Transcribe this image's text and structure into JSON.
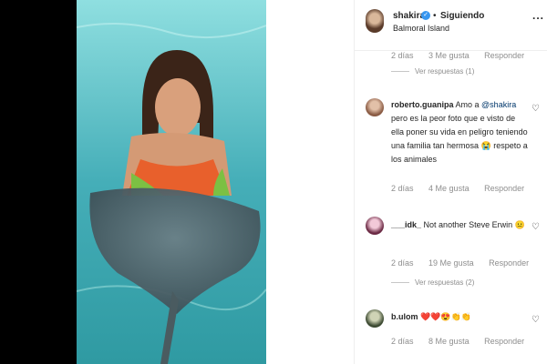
{
  "post": {
    "username": "shakira",
    "separator": "•",
    "follow_label": "Siguiendo",
    "location": "Balmoral Island",
    "more_label": "..."
  },
  "icons": {
    "verified": "verified-badge-icon",
    "heart": "heart-outline-icon"
  },
  "top_meta": {
    "time": "2 días",
    "likes": "3 Me gusta",
    "reply": "Responder"
  },
  "top_replies": "Ver respuestas (1)",
  "comments": [
    {
      "user": "roberto.guanipa",
      "text_before": "Amo a ",
      "mention": "@shakira",
      "text_after": " pero es la peor foto que e visto de ella poner su vida en peligro teniendo una familia tan hermosa 😭 respeto a los animales",
      "time": "2 días",
      "likes": "4 Me gusta",
      "reply": "Responder"
    },
    {
      "user": "___idk_",
      "text": "Not another Steve Erwin 😐",
      "time": "2 días",
      "likes": "19 Me gusta",
      "reply": "Responder",
      "replies": "Ver respuestas (2)"
    },
    {
      "user": "b.ulom",
      "text": "❤️❤️😍👏👏",
      "time": "2 días",
      "likes": "8 Me gusta",
      "reply": "Responder"
    }
  ]
}
